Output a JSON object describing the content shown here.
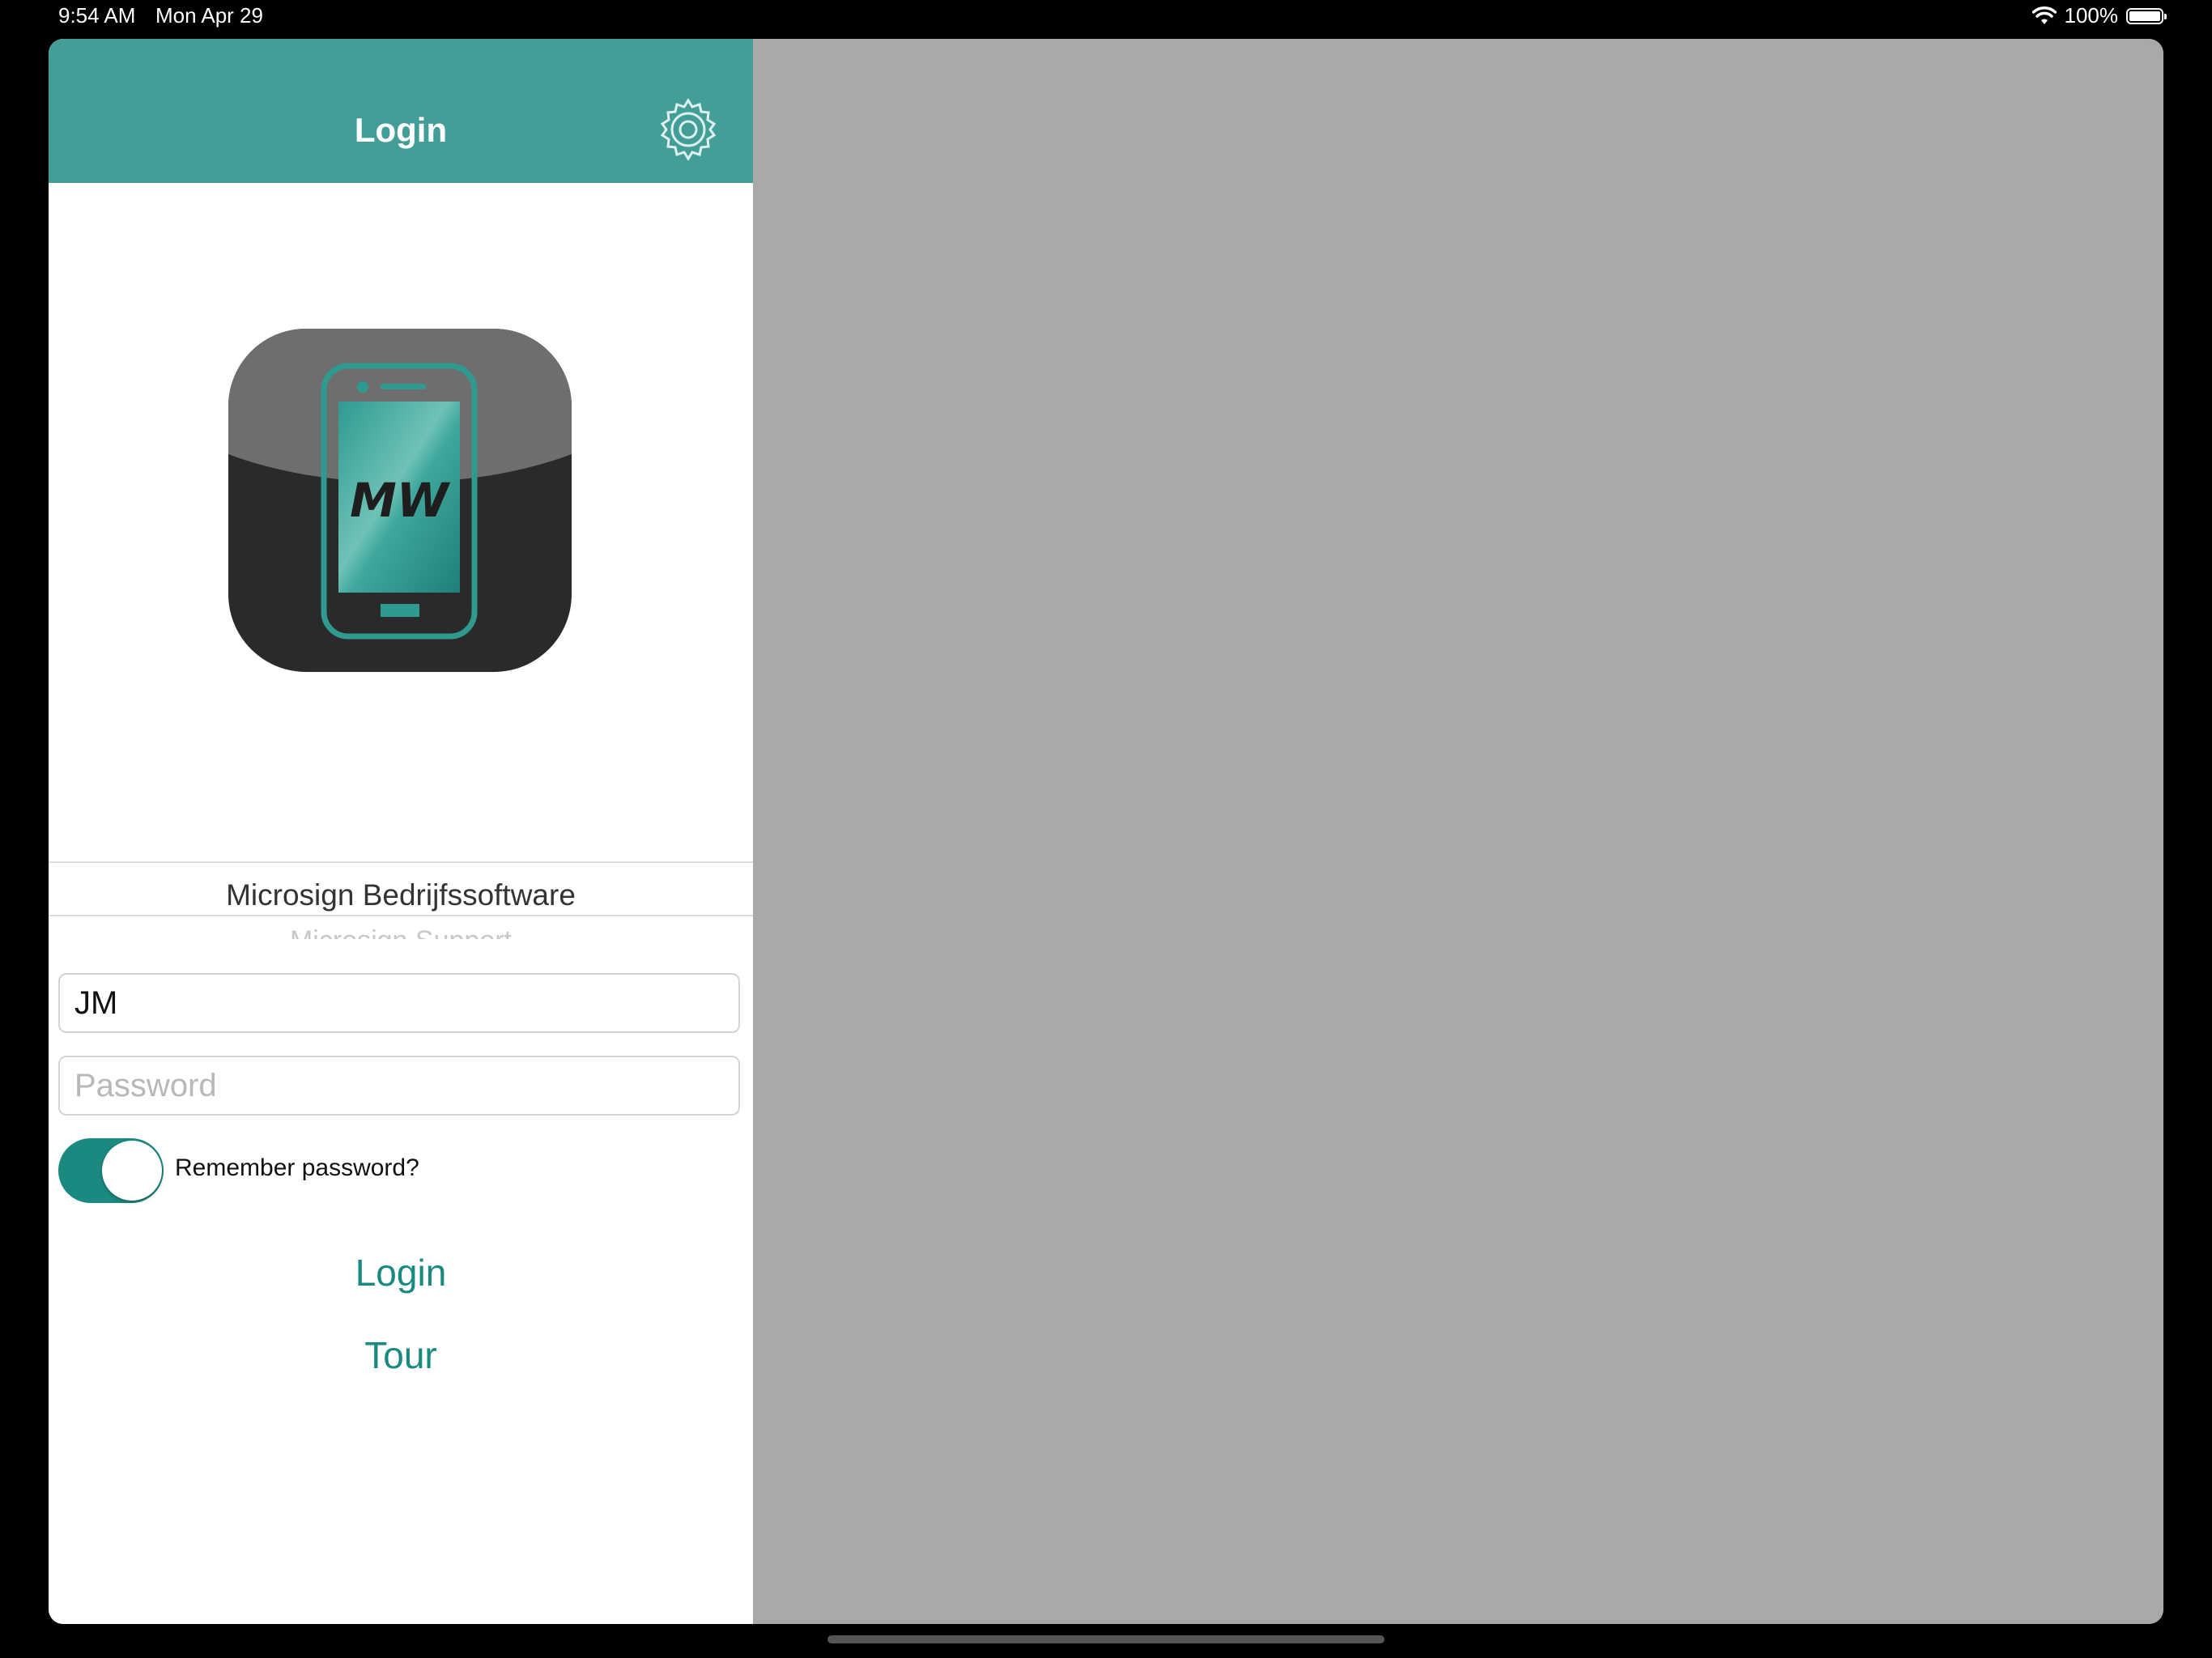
{
  "status_bar": {
    "time": "9:54 AM",
    "date": "Mon Apr 29",
    "battery": "100%"
  },
  "nav": {
    "title": "Login"
  },
  "logo": {
    "text": "MW"
  },
  "company_picker": {
    "selected": "Microsign Bedrijfssoftware",
    "next": "Microsign Support"
  },
  "login_form": {
    "username_value": "JM",
    "password_placeholder": "Password",
    "remember_label": "Remember password?",
    "remember_enabled": true,
    "login_label": "Login",
    "tour_label": "Tour"
  },
  "colors": {
    "nav_background": "#439e98",
    "accent": "#1a8a80",
    "detail_background": "#a9a9a9"
  }
}
